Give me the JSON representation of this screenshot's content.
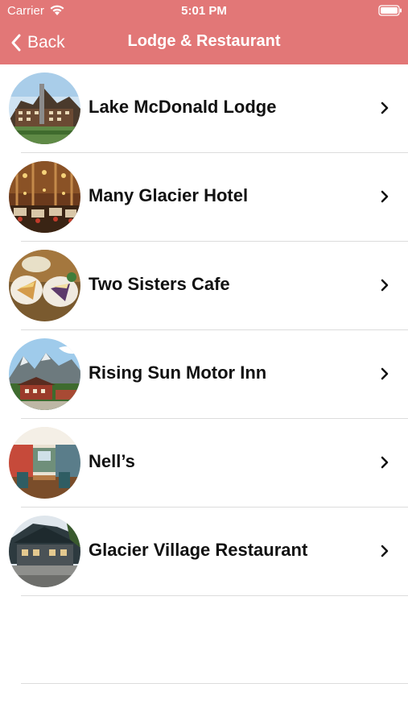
{
  "status_bar": {
    "carrier": "Carrier",
    "time": "5:01 PM"
  },
  "navbar": {
    "back_label": "Back",
    "title": "Lodge & Restaurant"
  },
  "colors": {
    "header_bg": "#e27777",
    "text_dark": "#111111"
  },
  "items": [
    {
      "label": "Lake McDonald Lodge",
      "icon": "lodge-photo"
    },
    {
      "label": "Many Glacier Hotel",
      "icon": "hotel-interior-photo"
    },
    {
      "label": "Two Sisters Cafe",
      "icon": "pie-dessert-photo"
    },
    {
      "label": "Rising Sun Motor Inn",
      "icon": "mountain-inn-photo"
    },
    {
      "label": "Nell’s",
      "icon": "restaurant-interior-photo"
    },
    {
      "label": "Glacier Village Restaurant",
      "icon": "restaurant-exterior-photo"
    }
  ]
}
